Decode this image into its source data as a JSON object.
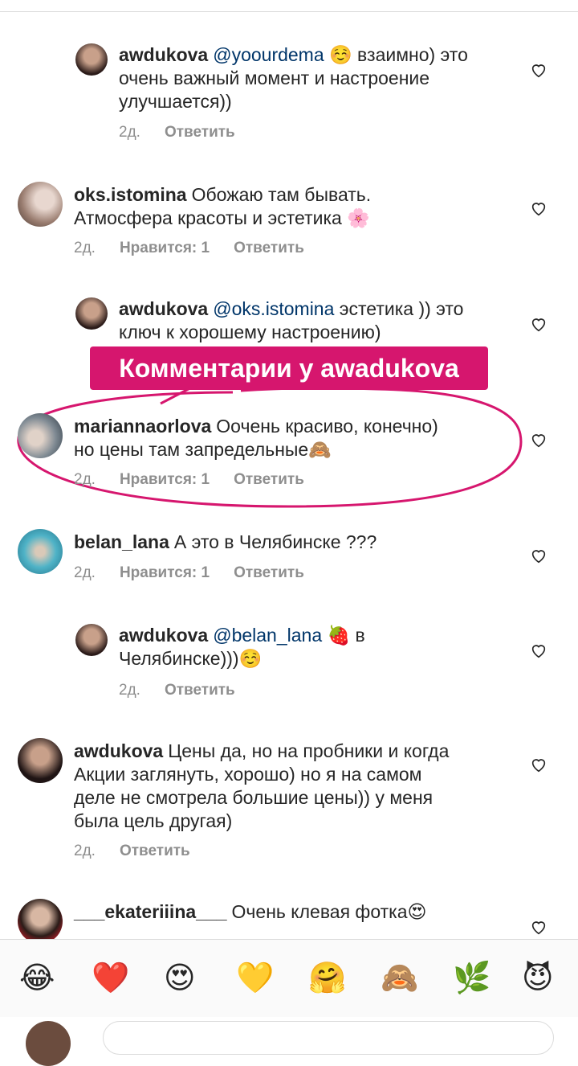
{
  "comments": [
    {
      "user": "awdukova",
      "mention": "@yoourdema",
      "pre": "",
      "post": " ☺️ взаимно) это",
      "line2": "очень важный момент и настроение",
      "line3": "улучшается))",
      "time": "2д.",
      "likes": "",
      "reply": "Ответить"
    },
    {
      "user": "oks.istomina",
      "line1": "Обожаю там бывать.",
      "line2": "Атмосфера красоты и эстетика 🌸",
      "time": "2д.",
      "likes": "Нравится: 1",
      "reply": "Ответить"
    },
    {
      "user": "awdukova",
      "mention": "@oks.istomina",
      "post": " эстетика )) это",
      "line2": "ключ к хорошему настроению)"
    },
    {
      "user": "mariannaorlova",
      "line1": "Оочень красиво, конечно)",
      "line2": "но цены там запредельные🙈",
      "time": "2д.",
      "likes": "Нравится: 1",
      "reply": "Ответить"
    },
    {
      "user": "belan_lana",
      "line1": "А это в Челябинске ???",
      "time": "2д.",
      "likes": "Нравится: 1",
      "reply": "Ответить"
    },
    {
      "user": "awdukova",
      "mention": "@belan_lana",
      "post": " 🍓  в",
      "line2": "Челябинске)))☺️",
      "time": "2д.",
      "reply": "Ответить"
    },
    {
      "user": "awdukova",
      "line1": "Цены да, но на пробники и когда",
      "line2": "Акции заглянуть, хорошо) но я на самом",
      "line3": "деле не смотрела большие цены)) у меня",
      "line4": "была цель другая)",
      "time": "2д.",
      "reply": "Ответить"
    },
    {
      "user": "___ekateriiina___",
      "line1": "Очень клевая фотка😍"
    }
  ],
  "banner": "Комментарии у awadukova",
  "emojis": [
    "😂",
    "❤️",
    "😍",
    "💛",
    "🤗",
    "🙈",
    "🌿",
    "😈"
  ],
  "colors": {
    "banner": "#d6166e",
    "mention": "#003569",
    "meta": "#8e8e8e"
  }
}
